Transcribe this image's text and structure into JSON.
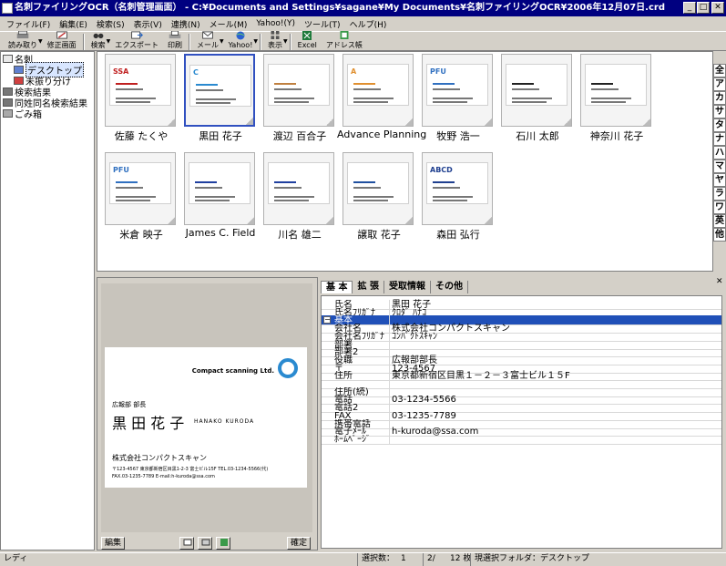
{
  "window": {
    "title": "名刺ファイリングOCR（名刺管理画面） - C:¥Documents and Settings¥sagane¥My Documents¥名刺ファイリングOCR¥2006年12月07日.crd",
    "minimize": "_",
    "maximize": "□",
    "close": "✕"
  },
  "menu": [
    "ファイル(F)",
    "編集(E)",
    "検索(S)",
    "表示(V)",
    "連携(N)",
    "メール(M)",
    "Yahoo!(Y)",
    "ツール(T)",
    "ヘルプ(H)"
  ],
  "toolbar": {
    "scan": "読み取り",
    "edit_screen": "修正画面",
    "search": "検索",
    "export": "エクスポート",
    "print": "印刷",
    "mail": "メール",
    "yahoo": "Yahoo!",
    "view": "表示",
    "excel": "Excel",
    "address_book": "アドレス帳"
  },
  "tree": {
    "root": "名刺",
    "desktop": "デスクトップ",
    "unsorted": "未振り分け",
    "search_results": "検索結果",
    "same_name_results": "同姓同名検索結果",
    "trash": "ごみ箱"
  },
  "cards": [
    {
      "name": "佐藤 たくや",
      "logo": "SSA",
      "accent": "#c02020"
    },
    {
      "name": "黒田 花子",
      "logo": "C",
      "accent": "#2a8ad0",
      "selected": true
    },
    {
      "name": "渡辺 百合子",
      "logo": "",
      "accent": "#c08040"
    },
    {
      "name": "Advance Planning",
      "logo": "A",
      "accent": "#e09030"
    },
    {
      "name": "牧野 浩一",
      "logo": "PFU",
      "accent": "#3070c0"
    },
    {
      "name": "石川 太郎",
      "logo": "",
      "accent": "#222222"
    },
    {
      "name": "神奈川 花子",
      "logo": "",
      "accent": "#222222"
    },
    {
      "name": "米倉 映子",
      "logo": "PFU",
      "accent": "#3070c0"
    },
    {
      "name": "James C. Field",
      "logo": "",
      "accent": "#2040a0"
    },
    {
      "name": "川名 雄二",
      "logo": "",
      "accent": "#2040a0"
    },
    {
      "name": "譲取 花子",
      "logo": "",
      "accent": "#2050a0"
    },
    {
      "name": "森田 弘行",
      "logo": "ABCD",
      "accent": "#204090"
    }
  ],
  "index_tabs": [
    "全",
    "ア",
    "カ",
    "サ",
    "タ",
    "ナ",
    "ハ",
    "マ",
    "ヤ",
    "ラ",
    "ワ",
    "英",
    "他"
  ],
  "preview": {
    "company_en": "Compact scanning Ltd.",
    "title": "広報部 部長",
    "name": "黒 田 花 子",
    "name_en": "HANAKO KURODA",
    "company": "株式会社コンパクトスキャン",
    "address_line": "〒123-4567 東京都新宿区目黒1-2-3 富士ビル15F TEL.03-1234-5566(代)",
    "fax_line": "FAX.03-1235-7789 E-mail:h-kuroda@ssa.com",
    "edit_button": "編集",
    "confirm_button": "確定"
  },
  "detail": {
    "tabs": [
      "基 本",
      "拡 張",
      "受取情報",
      "その他"
    ],
    "fields": [
      {
        "label": "氏名",
        "value": "黒田 花子"
      },
      {
        "label": "氏名ﾌﾘｶﾞﾅ",
        "value": "ｸﾛﾀﾞ ﾊﾅｺ"
      },
      {
        "label": "基本",
        "value": "",
        "header": true
      },
      {
        "label": "会社名",
        "value": "株式会社コンパクトスキャン"
      },
      {
        "label": "会社名ﾌﾘｶﾞﾅ",
        "value": "ｺﾝﾊﾟｸﾄｽｷｬﾝ"
      },
      {
        "label": "部署",
        "value": ""
      },
      {
        "label": "部署2",
        "value": ""
      },
      {
        "label": "役職",
        "value": "広報部部長"
      },
      {
        "label": "〒",
        "value": "123-4567"
      },
      {
        "label": "住所",
        "value": "東京都新宿区目黒１－２－３富士ビル１５F"
      },
      {
        "label": "",
        "value": ""
      },
      {
        "label": "住所(続)",
        "value": ""
      },
      {
        "label": "電話",
        "value": "03-1234-5566"
      },
      {
        "label": "電話2",
        "value": ""
      },
      {
        "label": "FAX",
        "value": "03-1235-7789"
      },
      {
        "label": "携帯電話",
        "value": ""
      },
      {
        "label": "電子ﾒｰﾙ",
        "value": "h-kuroda@ssa.com"
      },
      {
        "label": "ﾎｰﾑﾍﾟｰｼﾞ",
        "value": ""
      }
    ]
  },
  "status": {
    "ready": "レディ",
    "selected_label": "選択数：",
    "selected_count": "1",
    "position": "2/",
    "total": "12 枚",
    "folder": "現選択フォルダ：デスクトップ"
  }
}
